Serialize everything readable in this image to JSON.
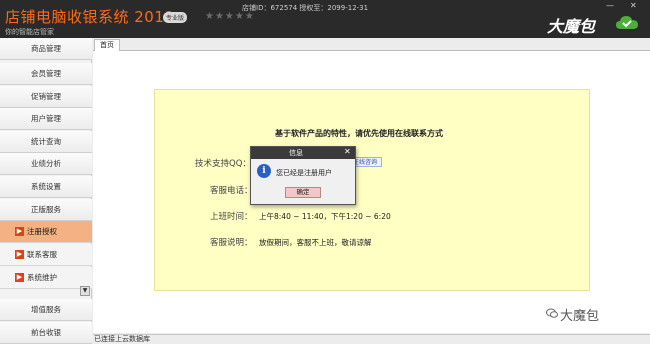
{
  "titlebar": {
    "app_title": "店铺电脑收银系统 2019",
    "edition_badge": "专业版",
    "stars": "★★★★★",
    "shop_info": "店铺ID：672574  授权至：2099-12-31",
    "slogan": "你的智能店管家",
    "minimize": "—",
    "close": "✕",
    "brand": "大魔包",
    "cloud_icon": "cloud-check-icon",
    "brand_color": "#ff6a1a"
  },
  "sidebar": {
    "items": [
      {
        "label": "商品管理"
      },
      {
        "label": "会员管理"
      },
      {
        "label": "促销管理"
      },
      {
        "label": "用户管理"
      },
      {
        "label": "统计查询"
      },
      {
        "label": "业绩分析"
      },
      {
        "label": "系统设置"
      },
      {
        "label": "正版服务"
      }
    ],
    "sub_items": [
      {
        "label": "注册授权",
        "active": true
      },
      {
        "label": "联系客服",
        "active": false
      },
      {
        "label": "系统维护",
        "active": false
      }
    ],
    "bottom_items": [
      {
        "label": "增值服务"
      },
      {
        "label": "前台收银"
      }
    ],
    "scroll_glyph": "▼"
  },
  "main": {
    "tab": "首页",
    "panel": {
      "title": "基于软件产品的特性，请优先使用在线联系方式",
      "qq_label": "技术支持QQ：",
      "online_button": "在线咨询",
      "phone_label": "客服电话：",
      "hours_label": "上班时间：",
      "hours_value": "上午8:40 ~ 11:40，下午1:20 ~ 6:20",
      "note_label": "客服说明：",
      "note_value": "放假期间，客服不上班，敬请谅解"
    },
    "highlight_color": "#ffffc4"
  },
  "dialog": {
    "title": "信息",
    "close": "✕",
    "icon_glyph": "i",
    "message": "您已经是注册用户",
    "ok": "确定"
  },
  "status": {
    "text": "已连接上云数据库"
  },
  "watermark": {
    "text": "大魔包",
    "icon": "wechat-icon"
  }
}
